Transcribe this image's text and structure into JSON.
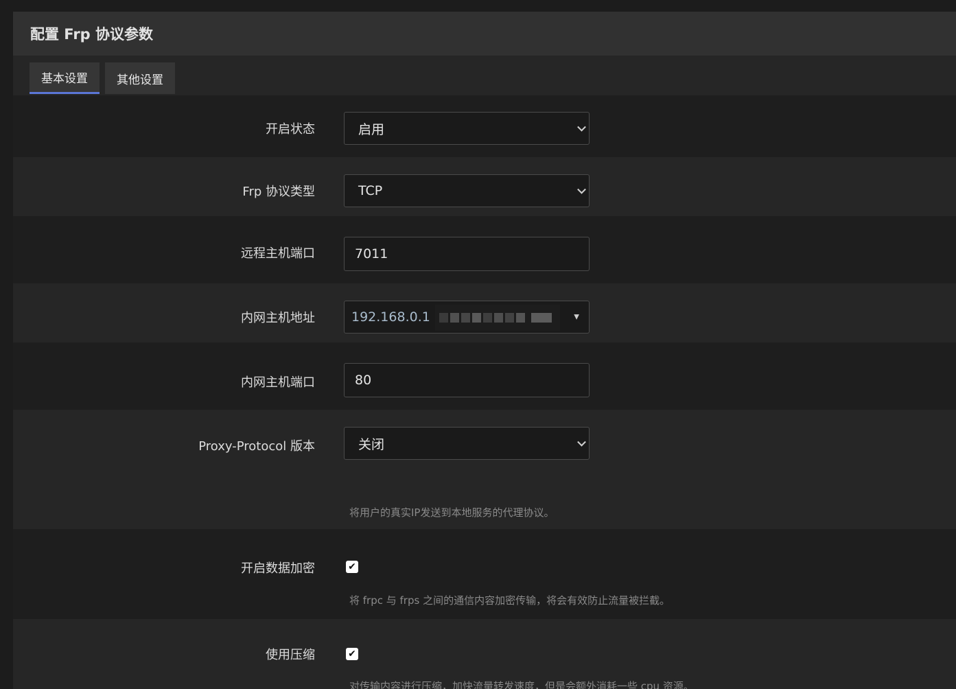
{
  "header": {
    "title": "配置 Frp 协议参数"
  },
  "tabs": [
    {
      "label": "基本设置",
      "active": true
    },
    {
      "label": "其他设置",
      "active": false
    }
  ],
  "fields": {
    "status": {
      "label": "开启状态",
      "value": "启用"
    },
    "protocol_type": {
      "label": "Frp 协议类型",
      "value": "TCP"
    },
    "remote_port": {
      "label": "远程主机端口",
      "value": "7011"
    },
    "local_ip": {
      "label": "内网主机地址",
      "value": "192.168.0.1 ("
    },
    "local_port": {
      "label": "内网主机端口",
      "value": "80"
    },
    "proxy_protocol": {
      "label": "Proxy-Protocol 版本",
      "value": "关闭",
      "hint": "将用户的真实IP发送到本地服务的代理协议。"
    },
    "encryption": {
      "label": "开启数据加密",
      "checked": true,
      "hint": "将 frpc 与 frps 之间的通信内容加密传输，将会有效防止流量被拦截。"
    },
    "compression": {
      "label": "使用压缩",
      "checked": true,
      "hint": "对传输内容进行压缩，加快流量转发速度，但是会额外消耗一些 cpu 资源。"
    }
  },
  "colors": {
    "accent": "#5b76d6",
    "background": "#1e1e1e",
    "row_alt": "#262626"
  }
}
